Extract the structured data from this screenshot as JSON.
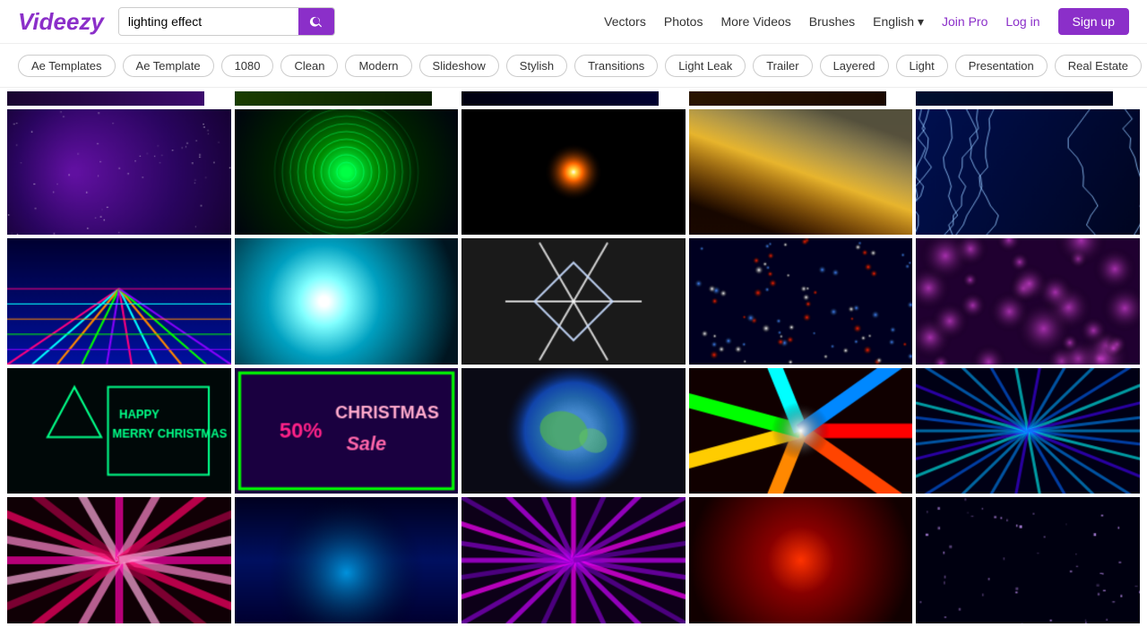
{
  "header": {
    "logo": "Videezy",
    "search_placeholder": "lighting effect",
    "search_value": "lighting effect",
    "nav": {
      "vectors": "Vectors",
      "photos": "Photos",
      "more_videos": "More Videos",
      "brushes": "Brushes",
      "language": "English ▾",
      "join_pro": "Join Pro",
      "log_in": "Log in",
      "sign_up": "Sign up"
    }
  },
  "tags": [
    {
      "label": "Ae Templates",
      "active": false
    },
    {
      "label": "Ae Template",
      "active": false
    },
    {
      "label": "1080",
      "active": false
    },
    {
      "label": "Clean",
      "active": false
    },
    {
      "label": "Modern",
      "active": false
    },
    {
      "label": "Slideshow",
      "active": false
    },
    {
      "label": "Stylish",
      "active": false
    },
    {
      "label": "Transitions",
      "active": false
    },
    {
      "label": "Light Leak",
      "active": false
    },
    {
      "label": "Trailer",
      "active": false
    },
    {
      "label": "Layered",
      "active": false
    },
    {
      "label": "Light",
      "active": false
    },
    {
      "label": "Presentation",
      "active": false
    },
    {
      "label": "Real Estate",
      "active": false
    }
  ],
  "grid": {
    "rows": 4,
    "cols": 5
  }
}
